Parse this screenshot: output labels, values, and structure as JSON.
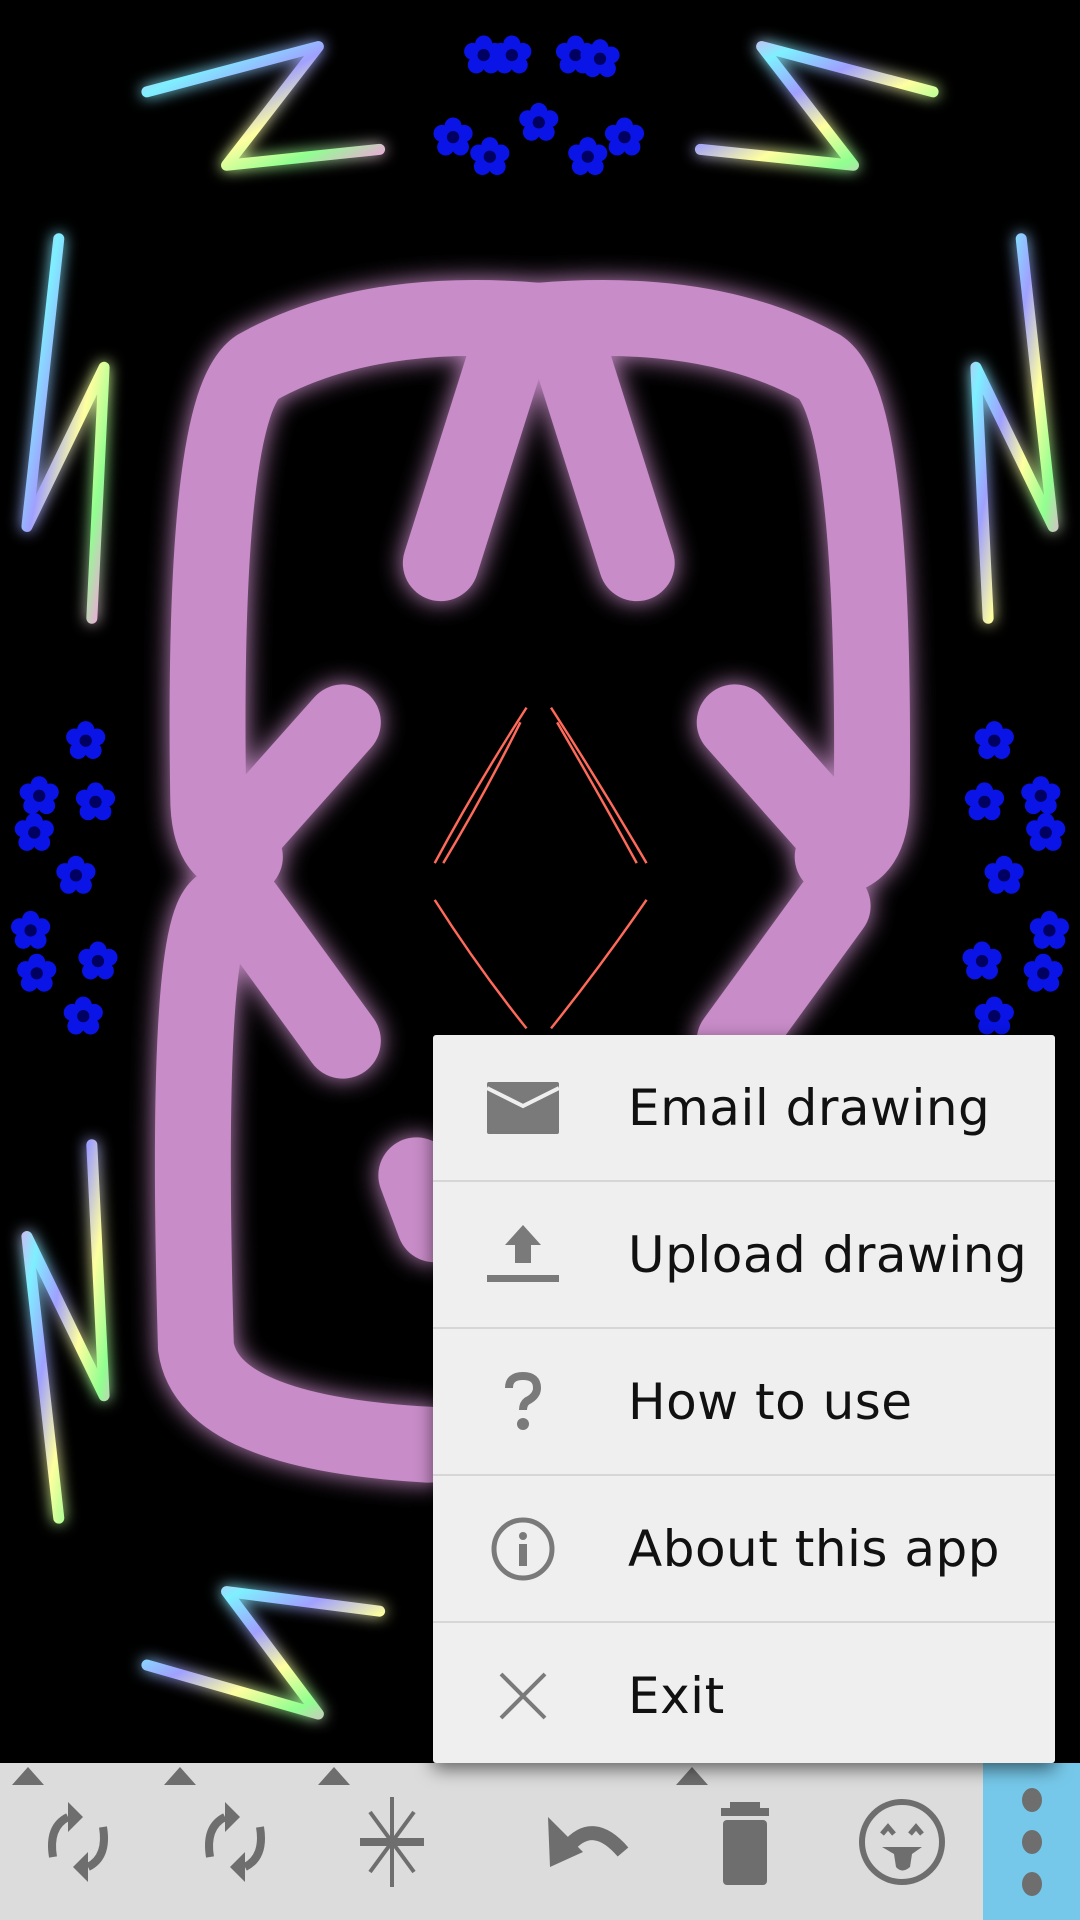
{
  "menu": {
    "items": [
      {
        "label": "Email drawing",
        "icon": "email-icon"
      },
      {
        "label": "Upload drawing",
        "icon": "upload-icon"
      },
      {
        "label": "How to use",
        "icon": "help-icon"
      },
      {
        "label": "About this app",
        "icon": "info-icon"
      },
      {
        "label": "Exit",
        "icon": "close-icon"
      }
    ]
  },
  "toolbar": {
    "buttons": [
      {
        "icon": "rotate-icon",
        "has_dropdown": true
      },
      {
        "icon": "rotate-icon",
        "has_dropdown": true
      },
      {
        "icon": "symmetry-icon",
        "has_dropdown": true
      },
      {
        "icon": "undo-icon",
        "has_dropdown": false
      },
      {
        "icon": "trash-icon",
        "has_dropdown": true
      },
      {
        "icon": "emoji-icon",
        "has_dropdown": false
      },
      {
        "icon": "overflow-menu-icon",
        "active": true
      }
    ]
  },
  "colors": {
    "canvas_background": "#000000",
    "toolbar_background": "#dcdcdc",
    "overflow_active": "#76c8ea",
    "menu_background": "#efefef",
    "icon_gray": "#6e6e6e",
    "brush_pink": "#c88cc8",
    "brush_glow": "#c000c0",
    "flower_blue": "#0a14e6",
    "line_red": "#ff6a5a"
  }
}
